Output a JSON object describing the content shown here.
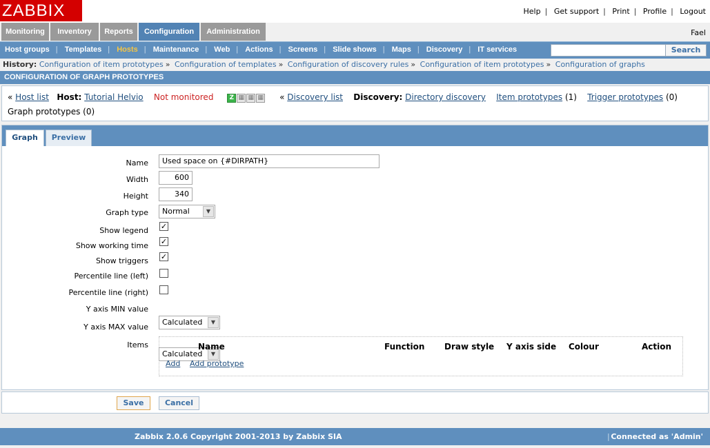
{
  "logo": "ZABBIX",
  "top_links": [
    "Help",
    "Get support",
    "Print",
    "Profile",
    "Logout"
  ],
  "main_menu": [
    "Monitoring",
    "Inventory",
    "Reports",
    "Configuration",
    "Administration"
  ],
  "user": "Fael",
  "sub_menu": [
    "Host groups",
    "Templates",
    "Hosts",
    "Maintenance",
    "Web",
    "Actions",
    "Screens",
    "Slide shows",
    "Maps",
    "Discovery",
    "IT services"
  ],
  "sub_menu_active": "Hosts",
  "search": {
    "value": "",
    "button": "Search"
  },
  "history": {
    "label": "History:",
    "items": [
      "Configuration of item prototypes",
      "Configuration of templates",
      "Configuration of discovery rules",
      "Configuration of item prototypes",
      "Configuration of graphs"
    ]
  },
  "section_title": "CONFIGURATION OF GRAPH PROTOTYPES",
  "info": {
    "host_list": "Host list",
    "host_label": "Host:",
    "host_name": "Tutorial Helvio",
    "host_status": "Not monitored",
    "discovery_list": "Discovery list",
    "discovery_label": "Discovery:",
    "discovery_name": "Directory discovery",
    "item_prototypes": "Item prototypes",
    "item_prototypes_count": "(1)",
    "trigger_prototypes": "Trigger prototypes",
    "trigger_prototypes_count": "(0)",
    "graph_prototypes": "Graph prototypes (0)",
    "status_icons": [
      "Z",
      "",
      "",
      ""
    ]
  },
  "tabs": [
    "Graph",
    "Preview"
  ],
  "form": {
    "name_label": "Name",
    "name_value": "Used space on {#DIRPATH}",
    "width_label": "Width",
    "width_value": "600",
    "height_label": "Height",
    "height_value": "340",
    "graph_type_label": "Graph type",
    "graph_type_value": "Normal",
    "show_legend_label": "Show legend",
    "show_legend": true,
    "show_working_time_label": "Show working time",
    "show_working_time": true,
    "show_triggers_label": "Show triggers",
    "show_triggers": true,
    "percentile_left_label": "Percentile line (left)",
    "percentile_left": false,
    "percentile_right_label": "Percentile line (right)",
    "percentile_right": false,
    "y_min_label": "Y axis MIN value",
    "y_min_value": "Calculated",
    "y_max_label": "Y axis MAX value",
    "y_max_value": "Calculated",
    "items_label": "Items",
    "items_headers": [
      "Name",
      "Function",
      "Draw style",
      "Y axis side",
      "Colour",
      "Action"
    ],
    "add": "Add",
    "add_prototype": "Add prototype"
  },
  "buttons": {
    "save": "Save",
    "cancel": "Cancel"
  },
  "footer": {
    "copyright": "Zabbix 2.0.6 Copyright 2001-2013 by Zabbix SIA",
    "separator": "|",
    "connected": "Connected as 'Admin'"
  },
  "icons": {
    "dropdown": "chevron-down-icon",
    "checkbox": "checkmark-icon"
  },
  "colors": {
    "accent": "#5f8fbe",
    "logo": "#d40000",
    "active_submenu": "#f6c543",
    "not_monitored": "#cc2222"
  }
}
